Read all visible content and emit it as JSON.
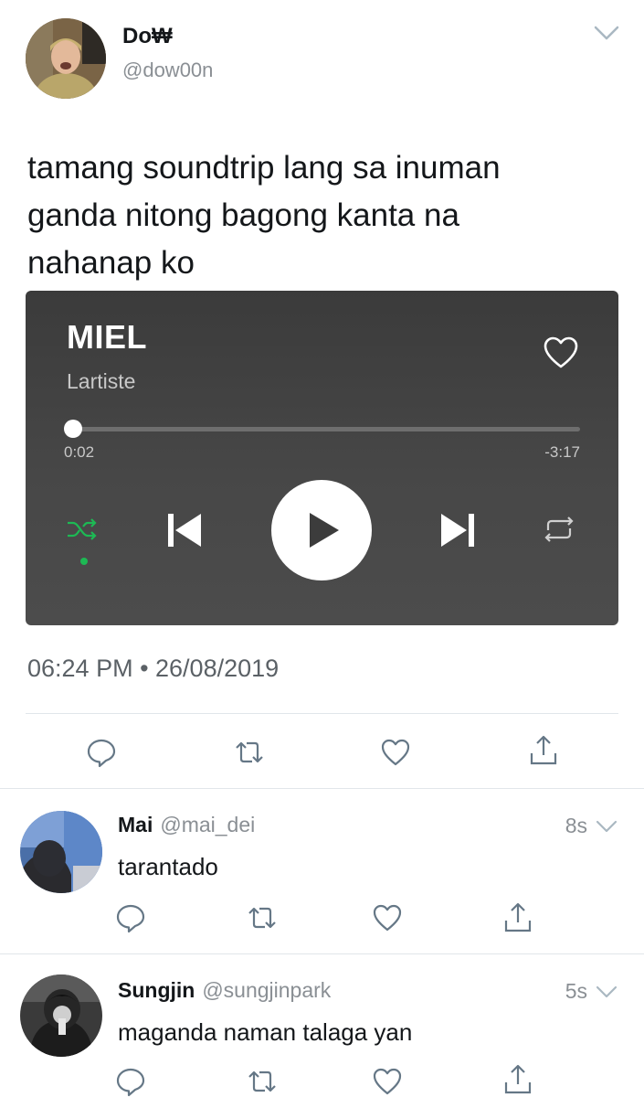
{
  "tweet": {
    "author_name": "Do₩",
    "author_handle": "@dow00n",
    "text_lines": [
      "tamang soundtrip lang sa inuman",
      "ganda nitong bagong kanta na",
      "nahanap ko"
    ],
    "timestamp": "06:24 PM • 26/08/2019"
  },
  "player": {
    "title": "MIEL",
    "artist": "Lartiste",
    "elapsed": "0:02",
    "remaining": "-3:17",
    "progress_fraction": 0.01,
    "shuffle_active": true,
    "accent_color": "#1db954"
  },
  "icons": {
    "reply": "reply-icon",
    "retweet": "retweet-icon",
    "like": "heart-icon",
    "share": "share-icon"
  },
  "replies": [
    {
      "name": "Mai",
      "handle": "@mai_dei",
      "time": "8s",
      "text": "tarantado"
    },
    {
      "name": "Sungjin",
      "handle": "@sungjinpark",
      "time": "5s",
      "text": "maganda naman talaga yan"
    }
  ]
}
